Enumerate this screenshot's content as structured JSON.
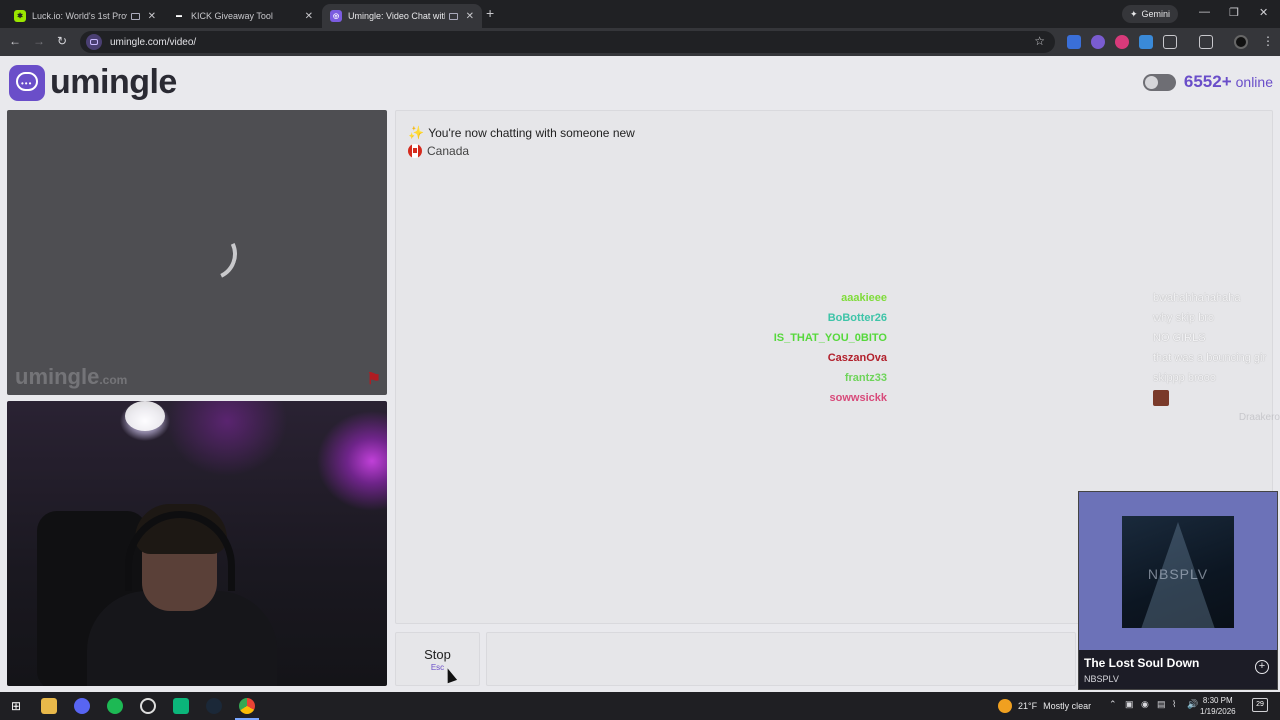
{
  "browser": {
    "tabs": [
      {
        "title": "Luck.io: World's 1st Provabl",
        "favicon_color": "#9ae600"
      },
      {
        "title": "KICK Giveaway Tool",
        "favicon_color": "#ffffff"
      },
      {
        "title": "Umingle: Video Chat with S",
        "favicon_color": "#7b5ce0",
        "active": true
      }
    ],
    "new_tab_label": "+",
    "gemini_label": "Gemini",
    "url": "umingle.com/video/"
  },
  "site": {
    "logo_text": "umingle",
    "online_count": "6552+",
    "online_label": "online",
    "accent": "#6a4ec9"
  },
  "stranger_video": {
    "watermark": "umingle",
    "watermark_suffix": ".com"
  },
  "chat": {
    "system_message": "You're now chatting with someone new",
    "country": "Canada"
  },
  "overlay_chat": [
    {
      "user": "aaakieee",
      "text": "bwahahhahahaha",
      "color": "#7fdc3a"
    },
    {
      "user": "BoBotter26",
      "text": "why skip bro",
      "color": "#3ec4a8"
    },
    {
      "user": "IS_THAT_YOU_0BITO",
      "text": "NO GIRLS",
      "color": "#56d83c"
    },
    {
      "user": "CaszanOva",
      "text": "that was a bouncing gir",
      "color": "#b2202c"
    },
    {
      "user": "frantz33",
      "text": "skippp brooo",
      "color": "#6ed45a"
    },
    {
      "user": "sowwsickk",
      "text": "",
      "color": "#d84a7a",
      "emote": true
    }
  ],
  "overlay_faded": "Draakero",
  "controls": {
    "stop_label": "Stop",
    "stop_shortcut": "Esc"
  },
  "music": {
    "cover_text": "NBSPLV",
    "title": "The Lost Soul Down",
    "artist": "NBSPLV"
  },
  "taskbar": {
    "temperature": "21°F",
    "weather": "Mostly clear",
    "time": "8:30 PM",
    "date": "1/19/2026",
    "notifications": "29"
  }
}
